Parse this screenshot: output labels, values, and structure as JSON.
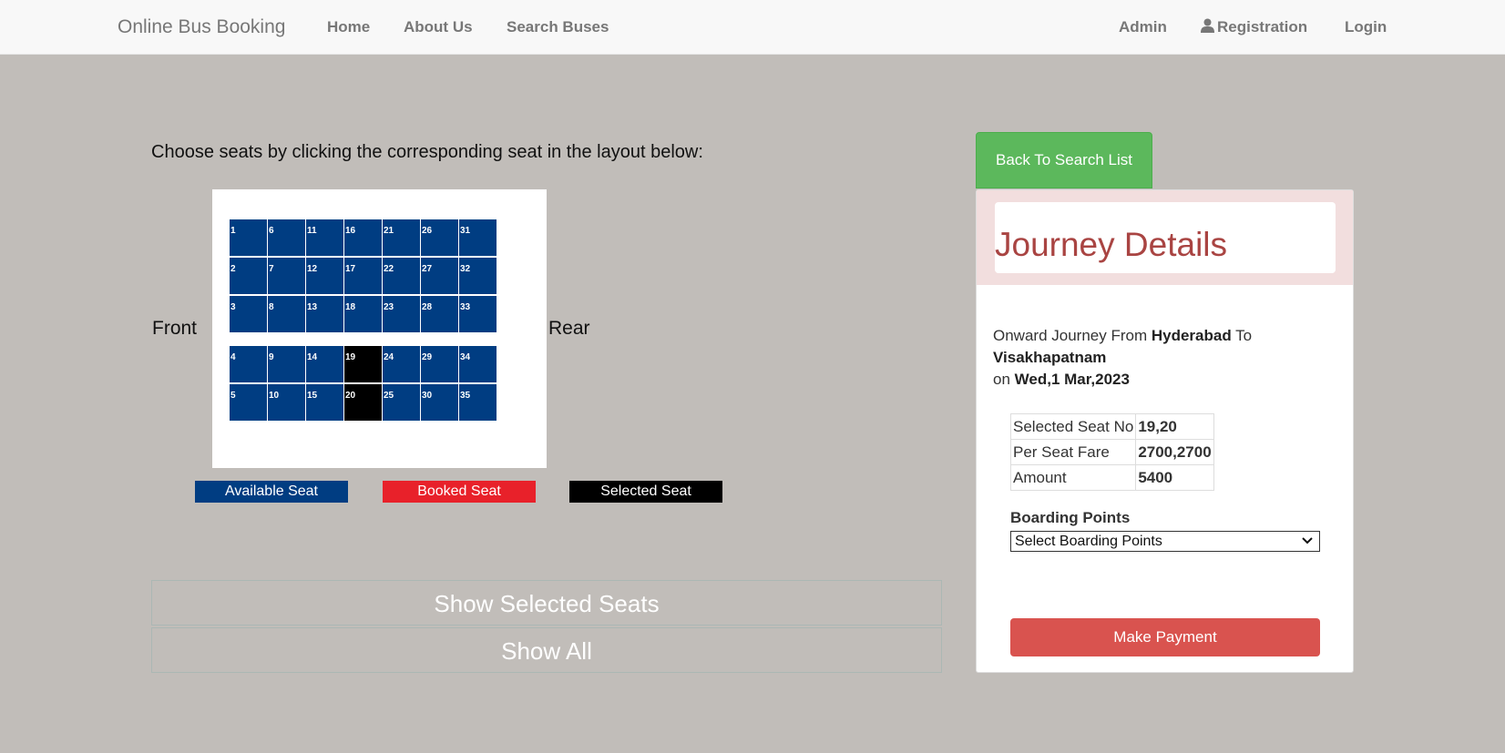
{
  "nav": {
    "brand": "Online Bus Booking",
    "home": "Home",
    "about": "About Us",
    "search": "Search Buses",
    "admin": "Admin",
    "registration": "Registration",
    "login": "Login"
  },
  "seat_layout": {
    "instruction": "Choose seats by clicking the corresponding seat in the layout below:",
    "front": "Front",
    "rear": "Rear",
    "seats": [
      {
        "no": "1",
        "status": "available"
      },
      {
        "no": "2",
        "status": "available"
      },
      {
        "no": "3",
        "status": "available"
      },
      {
        "no": "4",
        "status": "available"
      },
      {
        "no": "5",
        "status": "available"
      },
      {
        "no": "6",
        "status": "available"
      },
      {
        "no": "7",
        "status": "available"
      },
      {
        "no": "8",
        "status": "available"
      },
      {
        "no": "9",
        "status": "available"
      },
      {
        "no": "10",
        "status": "available"
      },
      {
        "no": "11",
        "status": "available"
      },
      {
        "no": "12",
        "status": "available"
      },
      {
        "no": "13",
        "status": "available"
      },
      {
        "no": "14",
        "status": "available"
      },
      {
        "no": "15",
        "status": "available"
      },
      {
        "no": "16",
        "status": "available"
      },
      {
        "no": "17",
        "status": "available"
      },
      {
        "no": "18",
        "status": "available"
      },
      {
        "no": "19",
        "status": "selected"
      },
      {
        "no": "20",
        "status": "selected"
      },
      {
        "no": "21",
        "status": "available"
      },
      {
        "no": "22",
        "status": "available"
      },
      {
        "no": "23",
        "status": "available"
      },
      {
        "no": "24",
        "status": "available"
      },
      {
        "no": "25",
        "status": "available"
      },
      {
        "no": "26",
        "status": "available"
      },
      {
        "no": "27",
        "status": "available"
      },
      {
        "no": "28",
        "status": "available"
      },
      {
        "no": "29",
        "status": "available"
      },
      {
        "no": "30",
        "status": "available"
      },
      {
        "no": "31",
        "status": "available"
      },
      {
        "no": "32",
        "status": "available"
      },
      {
        "no": "33",
        "status": "available"
      },
      {
        "no": "34",
        "status": "available"
      },
      {
        "no": "35",
        "status": "available"
      }
    ],
    "legend": {
      "available": "Available Seat",
      "booked": "Booked Seat",
      "selected": "Selected Seat"
    },
    "colors": {
      "available": "#003d82",
      "booked": "#e8212a",
      "selected": "#000000"
    },
    "show_selected": "Show Selected Seats",
    "show_all": "Show All"
  },
  "journey": {
    "back_button": "Back To Search List",
    "title": "Journey Details",
    "from_prefix": "Onward Journey From",
    "from": "Hyderabad",
    "to_word": "To",
    "to": "Visakhapatnam",
    "on_word": "on",
    "date": "Wed,1 Mar,2023",
    "fare_table": [
      {
        "label": "Selected Seat No",
        "value": "19,20"
      },
      {
        "label": "Per Seat Fare",
        "value": "2700,2700"
      },
      {
        "label": "Amount",
        "value": "5400"
      }
    ],
    "boarding_label": "Boarding Points",
    "boarding_selected": "Select Boarding Points",
    "pay_button": "Make Payment"
  }
}
